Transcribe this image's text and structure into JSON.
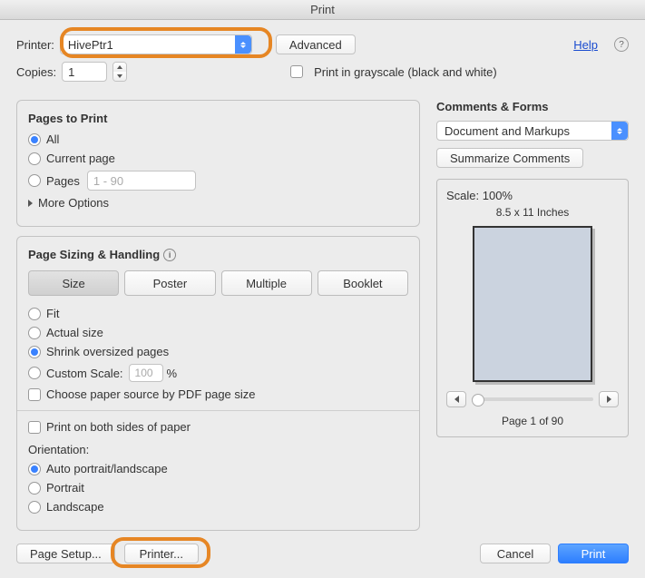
{
  "title": "Print",
  "top": {
    "printer_label": "Printer:",
    "printer_value": "HivePtr1",
    "advanced": "Advanced",
    "help": "Help",
    "copies_label": "Copies:",
    "copies_value": "1",
    "grayscale": "Print in grayscale (black and white)"
  },
  "pages": {
    "heading": "Pages to Print",
    "all": "All",
    "current": "Current page",
    "pages_label": "Pages",
    "range_placeholder": "1 - 90",
    "more": "More Options"
  },
  "sizing": {
    "heading": "Page Sizing & Handling",
    "tabs": {
      "size": "Size",
      "poster": "Poster",
      "multiple": "Multiple",
      "booklet": "Booklet"
    },
    "fit": "Fit",
    "actual": "Actual size",
    "shrink": "Shrink oversized pages",
    "custom_label": "Custom Scale:",
    "custom_value": "100",
    "custom_pct": "%",
    "choose_source": "Choose paper source by PDF page size",
    "both_sides": "Print on both sides of paper",
    "orientation_label": "Orientation:",
    "auto": "Auto portrait/landscape",
    "portrait": "Portrait",
    "landscape": "Landscape"
  },
  "comments": {
    "heading": "Comments & Forms",
    "mode": "Document and Markups",
    "summarize": "Summarize Comments"
  },
  "preview": {
    "scale": "Scale: 100%",
    "dim": "8.5 x 11 Inches",
    "page_label": "Page 1 of 90"
  },
  "footer": {
    "page_setup": "Page Setup...",
    "printer": "Printer...",
    "cancel": "Cancel",
    "print": "Print"
  }
}
